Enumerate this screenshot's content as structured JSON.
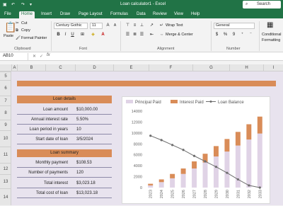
{
  "titlebar": {
    "title": "Loan calculator1 - Excel",
    "search_label": "Search"
  },
  "tabs": [
    "File",
    "Home",
    "Insert",
    "Draw",
    "Page Layout",
    "Formulas",
    "Data",
    "Review",
    "View",
    "Help"
  ],
  "active_tab": "Home",
  "ribbon": {
    "paste_label": "Paste",
    "cut_label": "Cut",
    "copy_label": "Copy",
    "format_painter_label": "Format Painter",
    "clipboard_group": "Clipboard",
    "font_name": "Century Gothic",
    "font_size": "11",
    "font_group": "Font",
    "wrap_text_label": "Wrap Text",
    "merge_center_label": "Merge & Center",
    "alignment_group": "Alignment",
    "number_format": "General",
    "currency_symbol": "$",
    "percent_symbol": "%",
    "comma_symbol": "9",
    "number_group": "Number",
    "cond_format_label_1": "Conditional",
    "cond_format_label_2": "Formatting"
  },
  "formula_bar": {
    "name_box": "AB10",
    "fx_label": "fx",
    "content": ""
  },
  "columns": [
    "A",
    "B",
    "C",
    "D",
    "E",
    "F",
    "G",
    "H",
    "I"
  ],
  "rows": [
    "5",
    "6",
    "7",
    "8",
    "9",
    "10",
    "11",
    "12",
    "13",
    "14"
  ],
  "loan_details": {
    "header": "Loan details",
    "rows": [
      {
        "label": "Loan amount",
        "value": "$10,000.00"
      },
      {
        "label": "Annual interest rate",
        "value": "5.50%"
      },
      {
        "label": "Loan period in years",
        "value": "10"
      },
      {
        "label": "Start date of loan",
        "value": "3/5/2024"
      }
    ]
  },
  "loan_summary": {
    "header": "Loan summary",
    "rows": [
      {
        "label": "Monthly payment",
        "value": "$108.53"
      },
      {
        "label": "Number of payments",
        "value": "120"
      },
      {
        "label": "Total interest",
        "value": "$3,023.18"
      },
      {
        "label": "Total cost of loan",
        "value": "$13,023.18"
      }
    ]
  },
  "colors": {
    "accent": "#217346",
    "header_orange": "#d98c58",
    "principal": "#e0d3e6",
    "interest": "#d98c58",
    "balance_line": "#6d6d6d",
    "sheet_bg": "#e8e3ee"
  },
  "chart_data": {
    "type": "bar",
    "stacked": true,
    "categories": [
      "2023",
      "2024",
      "2025",
      "2026",
      "2027",
      "2028",
      "2029",
      "2030",
      "2031",
      "2032",
      "2033"
    ],
    "series": [
      {
        "name": "Principal Paid",
        "values": [
          400,
          1000,
          1700,
          2500,
          3500,
          4600,
          5700,
          6600,
          7700,
          8800,
          9900
        ]
      },
      {
        "name": "Interest Paid",
        "values": [
          300,
          500,
          800,
          1000,
          1300,
          1600,
          1900,
          2300,
          2500,
          2800,
          3100
        ]
      },
      {
        "name": "Loan Balance",
        "type": "line",
        "values": [
          9500,
          8700,
          7800,
          6900,
          5800,
          4800,
          3800,
          2700,
          1500,
          400,
          0
        ]
      }
    ],
    "ylim": [
      0,
      14000
    ],
    "yticks": [
      "0",
      "2000",
      "4000",
      "6000",
      "8000",
      "10000",
      "12000",
      "14000"
    ],
    "legend": "top",
    "grid": false
  }
}
